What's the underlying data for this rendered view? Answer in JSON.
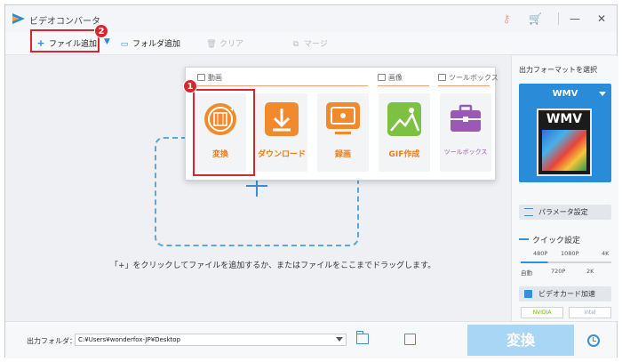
{
  "app": {
    "title": "ビデオコンバータ"
  },
  "toolbar": {
    "add_file": "ファイル追加",
    "add_folder": "フォルダ追加",
    "clear": "クリア",
    "merge": "マージ"
  },
  "badges": {
    "one": "1",
    "two": "2"
  },
  "popup": {
    "categories": {
      "video": "動画",
      "image": "画像",
      "toolbox": "ツールボックス"
    },
    "tiles": [
      {
        "label": "変換",
        "icon": "film-convert-icon"
      },
      {
        "label": "ダウンロード",
        "icon": "download-icon"
      },
      {
        "label": "録画",
        "icon": "screen-record-icon"
      },
      {
        "label": "GIF作成",
        "icon": "image-gif-icon"
      },
      {
        "label": "ツールボックス",
        "icon": "toolbox-icon"
      }
    ]
  },
  "main": {
    "hint": "「+」をクリックしてファイルを追加するか、またはファイルをここまでドラッグします。"
  },
  "right_panel": {
    "title": "出力フォーマットを選択",
    "format": "WMV",
    "thumb_text": "WMV",
    "param_settings": "パラメータ設定",
    "quick_settings": "クイック設定",
    "quick_top": [
      "480P",
      "1080P",
      "4K"
    ],
    "quick_bottom": [
      "自動",
      "720P",
      "2K"
    ],
    "gpu_accel": "ビデオカード加速",
    "vendors": [
      "NVIDIA",
      "intel"
    ]
  },
  "bottom": {
    "output_label": "出力フォルダ：",
    "output_path": "C:¥Users¥wonderfox-JP¥Desktop",
    "convert": "変換"
  },
  "colors": {
    "accent": "#2a8bd8",
    "highlight": "#d9252c",
    "tile_orange": "#f08a2c",
    "gif_green": "#7cc142",
    "toolbox_purple": "#9b59b6",
    "convert_disabled": "#a9d6f4"
  }
}
